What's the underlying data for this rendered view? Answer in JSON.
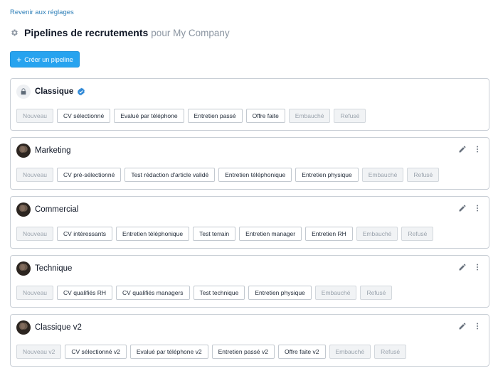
{
  "back_link": "Revenir aux réglages",
  "header": {
    "title": "Pipelines de recrutements",
    "subtitle": "pour My Company"
  },
  "create_button": {
    "label": "Créer un pipeline"
  },
  "colors": {
    "accent": "#27a3ef",
    "link": "#2e7fb8",
    "verified": "#2e88d6"
  },
  "pipelines": [
    {
      "name": "Classique",
      "icon": "lock-icon",
      "verified": true,
      "stages": [
        "Nouveau",
        "CV sélectionné",
        "Evalué par téléphone",
        "Entretien passé",
        "Offre faite",
        "Embauché",
        "Refusé"
      ]
    },
    {
      "name": "Marketing",
      "icon": "avatar",
      "stages": [
        "Nouveau",
        "CV pré-sélectionné",
        "Test rédaction d'article validé",
        "Entretien téléphonique",
        "Entretien physique",
        "Embauché",
        "Refusé"
      ]
    },
    {
      "name": "Commercial",
      "icon": "avatar",
      "stages": [
        "Nouveau",
        "CV intéressants",
        "Entretien téléphonique",
        "Test terrain",
        "Entretien manager",
        "Entretien RH",
        "Embauché",
        "Refusé"
      ]
    },
    {
      "name": "Technique",
      "icon": "avatar",
      "stages": [
        "Nouveau",
        "CV qualifiés RH",
        "CV qualifiés managers",
        "Test technique",
        "Entretien physique",
        "Embauché",
        "Refusé"
      ]
    },
    {
      "name": "Classique v2",
      "icon": "avatar",
      "stages": [
        "Nouveau v2",
        "CV sélectionné v2",
        "Evalué par téléphone v2",
        "Entretien passé v2",
        "Offre faite v2",
        "Embauché",
        "Refusé"
      ]
    }
  ]
}
